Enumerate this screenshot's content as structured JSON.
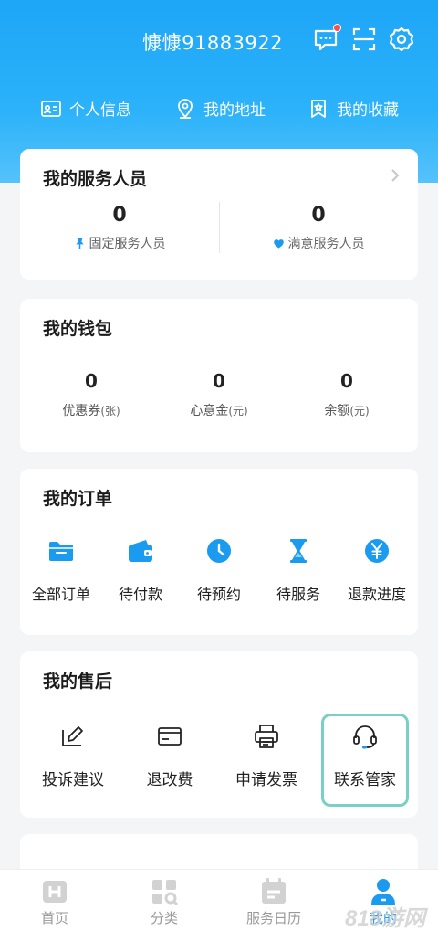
{
  "header": {
    "username": "慷慷91883922"
  },
  "quicklinks": [
    {
      "label": "个人信息",
      "icon": "id-card-icon"
    },
    {
      "label": "我的地址",
      "icon": "location-pin-icon"
    },
    {
      "label": "我的收藏",
      "icon": "bookmark-star-icon"
    }
  ],
  "staff": {
    "title": "我的服务人员",
    "fixed": {
      "count": "0",
      "label": "固定服务人员",
      "icon": "pin-icon"
    },
    "satisfied": {
      "count": "0",
      "label": "满意服务人员",
      "icon": "heart-icon"
    }
  },
  "wallet": {
    "title": "我的钱包",
    "items": [
      {
        "value": "0",
        "label": "优惠券",
        "unit": "(张)"
      },
      {
        "value": "0",
        "label": "心意金",
        "unit": "(元)"
      },
      {
        "value": "0",
        "label": "余额",
        "unit": "(元)"
      }
    ]
  },
  "orders": {
    "title": "我的订单",
    "items": [
      {
        "label": "全部订单",
        "icon": "folder-icon"
      },
      {
        "label": "待付款",
        "icon": "wallet-icon"
      },
      {
        "label": "待预约",
        "icon": "clock-icon"
      },
      {
        "label": "待服务",
        "icon": "hourglass-icon"
      },
      {
        "label": "退款进度",
        "icon": "yen-icon"
      }
    ]
  },
  "aftersale": {
    "title": "我的售后",
    "items": [
      {
        "label": "投诉建议",
        "icon": "edit-icon"
      },
      {
        "label": "退改费",
        "icon": "card-icon"
      },
      {
        "label": "申请发票",
        "icon": "printer-icon"
      },
      {
        "label": "联系管家",
        "icon": "headset-icon"
      }
    ]
  },
  "tabbar": [
    {
      "label": "首页",
      "icon": "home-icon"
    },
    {
      "label": "分类",
      "icon": "category-icon"
    },
    {
      "label": "服务日历",
      "icon": "calendar-icon"
    },
    {
      "label": "我的",
      "icon": "user-icon",
      "active": true
    }
  ],
  "colors": {
    "primary": "#1ea6f7",
    "accent_blue": "#1a9bf0",
    "highlight": "#7ad0c6"
  },
  "watermark": "818游网"
}
